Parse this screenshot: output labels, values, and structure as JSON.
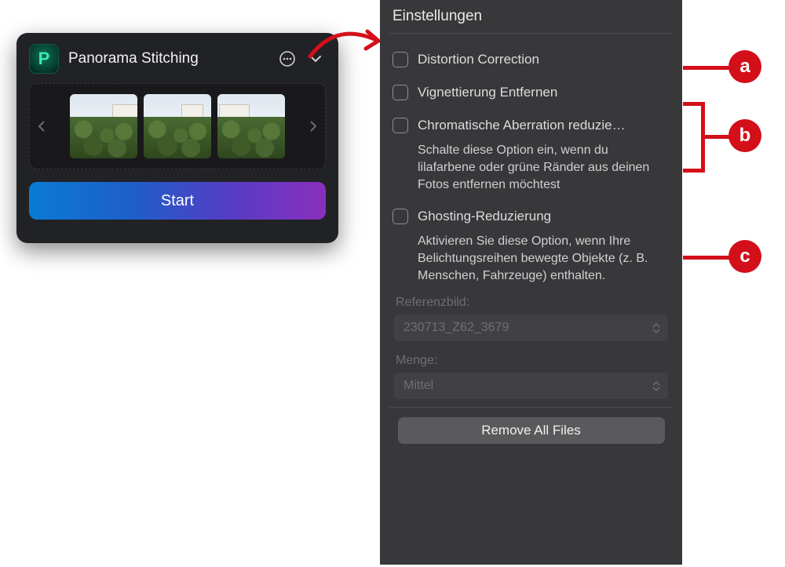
{
  "left_panel": {
    "app_icon_letter": "P",
    "title": "Panorama Stitching",
    "start_label": "Start"
  },
  "settings": {
    "title": "Einstellungen",
    "options": [
      {
        "label": "Distortion Correction",
        "checked": false
      },
      {
        "label": "Vignettierung Entfernen",
        "checked": false
      },
      {
        "label": "Chromatische Aberration reduzie…",
        "checked": false,
        "desc": "Schalte diese Option ein, wenn du lilafarbene oder grüne Ränder aus deinen Fotos entfernen möchtest"
      },
      {
        "label": "Ghosting-Reduzierung",
        "checked": false,
        "desc": "Aktivieren Sie diese Option, wenn Ihre Belichtungsreihen bewegte Objekte (z. B. Menschen, Fahrzeuge) enthalten."
      }
    ],
    "reference_label": "Referenzbild:",
    "reference_value": "230713_Z62_3679",
    "amount_label": "Menge:",
    "amount_value": "Mittel",
    "remove_label": "Remove All Files"
  },
  "annotations": {
    "a": "a",
    "b": "b",
    "c": "c"
  }
}
